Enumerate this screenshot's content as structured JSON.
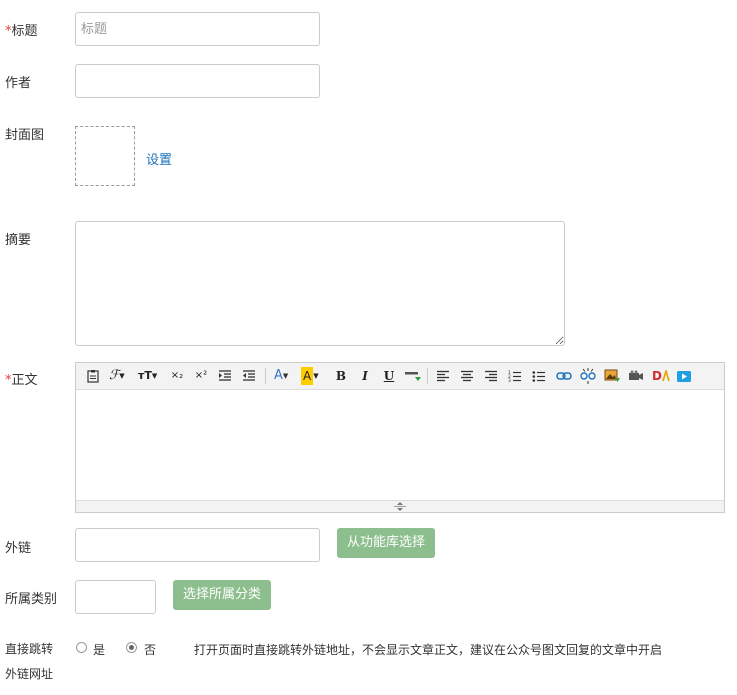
{
  "form": {
    "title": {
      "required_mark": "*",
      "label": "标题",
      "placeholder": "标题",
      "value": ""
    },
    "author": {
      "label": "作者",
      "value": ""
    },
    "cover": {
      "label": "封面图",
      "set_link": "设置"
    },
    "summary": {
      "label": "摘要",
      "value": ""
    },
    "body": {
      "required_mark": "*",
      "label": "正文"
    },
    "external_link": {
      "label": "外链",
      "value": "",
      "button": "从功能库选择"
    },
    "category": {
      "label": "所属类别",
      "value": "",
      "button": "选择所属分类"
    },
    "redirect": {
      "label_line1": "直接跳转",
      "label_line2": "外链网址",
      "option_yes": "是",
      "option_no": "否",
      "selected": "否",
      "hint": "打开页面时直接跳转外链地址，不会显示文章正文，建议在公众号图文回复的文章中开启"
    }
  },
  "editor_toolbar": {
    "icons": [
      "paste-icon",
      "font-family-icon",
      "font-size-icon",
      "subscript-icon",
      "superscript-icon",
      "indent-icon",
      "outdent-icon",
      "font-color-icon",
      "highlight-color-icon",
      "bold-icon",
      "italic-icon",
      "underline-icon",
      "insert-horizontal-rule-icon",
      "align-left-icon",
      "align-center-icon",
      "align-right-icon",
      "ordered-list-icon",
      "unordered-list-icon",
      "link-icon",
      "unlink-icon",
      "insert-image-icon",
      "insert-video-icon",
      "insert-flash-icon",
      "insert-media-icon"
    ],
    "glyphs": {
      "font_family": "ℱ",
      "font_size": "тT",
      "subscript": "×₂",
      "superscript": "×²",
      "font_color": "A",
      "highlight": "A",
      "bold": "B",
      "italic": "I",
      "underline": "U",
      "flash": "D"
    },
    "colors": {
      "font_color": "#3b73c9",
      "highlight": "#ffcc00",
      "link": "#1e73be",
      "button": "#8dbe8e"
    }
  }
}
